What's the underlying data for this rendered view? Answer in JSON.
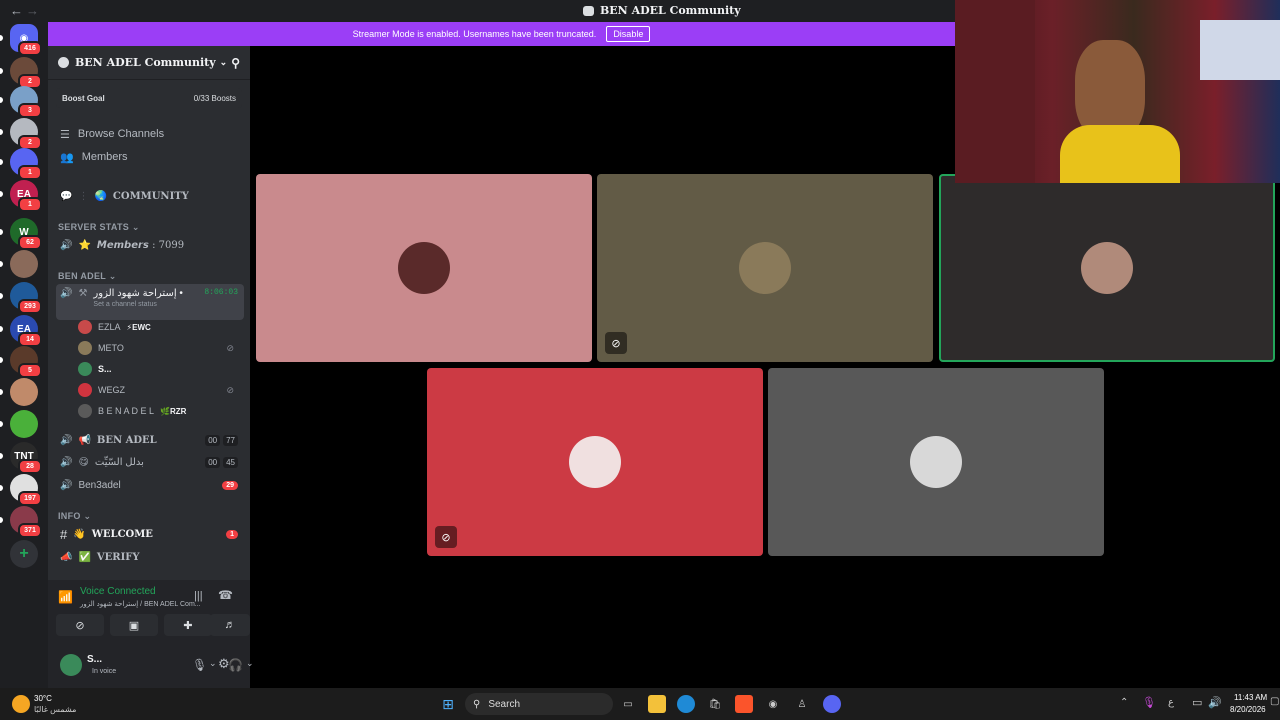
{
  "window": {
    "title": "BEN ADEL Community",
    "nav_back": "←",
    "nav_forward": "→"
  },
  "rail": {
    "servers": [
      {
        "kind": "home",
        "badge": "416",
        "color": "#5865f2"
      },
      {
        "kind": "avatar",
        "badge": "2",
        "color": "#6b4a3a"
      },
      {
        "kind": "avatar",
        "badge": "3",
        "color": "#7aa0c8"
      },
      {
        "kind": "avatar",
        "badge": "2",
        "color": "#b5b9c0"
      },
      {
        "kind": "avatar",
        "badge": "1",
        "color": "#5865f2"
      },
      {
        "kind": "text",
        "text": "EA",
        "badge": "1",
        "color": "#c02050"
      },
      {
        "kind": "text",
        "text": "W",
        "badge": "62",
        "color": "#1f6a2a"
      },
      {
        "kind": "avatar",
        "badge": "",
        "color": "#8a6a5a"
      },
      {
        "kind": "avatar",
        "badge": "293",
        "color": "#1f5a9a"
      },
      {
        "kind": "text",
        "text": "EA",
        "badge": "14",
        "color": "#2a4ab0"
      },
      {
        "kind": "avatar",
        "badge": "5",
        "color": "#5a3a2a"
      },
      {
        "kind": "avatar",
        "badge": "",
        "color": "#c08a6a"
      },
      {
        "kind": "avatar",
        "badge": "",
        "color": "#4ab03a"
      },
      {
        "kind": "text",
        "text": "TNT",
        "badge": "28",
        "color": "#2a2a2a"
      },
      {
        "kind": "avatar",
        "badge": "197",
        "color": "#e0e0e0"
      },
      {
        "kind": "avatar",
        "badge": "371",
        "color": "#8a3a4a"
      }
    ],
    "add_server": "+"
  },
  "banner": {
    "text": "Streamer Mode is enabled. Usernames have been truncated.",
    "button": "Disable"
  },
  "server": {
    "name": "BEN ADEL Community",
    "boost_label": "Boost Goal",
    "boost_value": "0/33 Boosts",
    "browse": "Browse Channels",
    "members": "Members"
  },
  "channels": {
    "community": "COMMUNITY",
    "cat_stats": "SERVER STATS",
    "members_stat": "𝙈𝙚𝙢𝙗𝙚𝙧𝙨 : 7099",
    "cat_benadel": "BEN ADEL",
    "voice_active": "إستراحة شهود الزور •",
    "voice_timer": "8:06:03",
    "voice_status": "Set a channel status",
    "members_list": [
      {
        "name": "EZLA",
        "tag": "⚡EWC",
        "color": "#c84a4a",
        "muted": false
      },
      {
        "name": "METO",
        "tag": "",
        "color": "#8a7a5a",
        "muted": true
      },
      {
        "name": "S...",
        "tag": "",
        "color": "#3a8a5a",
        "muted": false
      },
      {
        "name": "WEGZ",
        "tag": "",
        "color": "#d0343f",
        "muted": true
      },
      {
        "name": "B E N A D E L",
        "tag": "🌿RZR",
        "color": "#5a5a5a",
        "muted": false
      }
    ],
    "voice2": "BEN ADEL",
    "voice2_counts": [
      "00",
      "77"
    ],
    "voice3": "بدلل السّيِّت",
    "voice3_counts": [
      "00",
      "45"
    ],
    "voice4": "Ben3adel",
    "voice4_badge": "29",
    "cat_info": "INFO",
    "welcome": "WELCOME",
    "welcome_badge": "1",
    "verify": "VERIFY"
  },
  "voice_panel": {
    "status": "Voice Connected",
    "location": "إستراحة شهود الزور / BEN ADEL Com..."
  },
  "user": {
    "name": "S...",
    "status": "In voice"
  },
  "tiles": [
    {
      "bg": "#c98a8d",
      "avatar": "#5a2a2a",
      "muted": false,
      "speaking": false
    },
    {
      "bg": "#625b46",
      "avatar": "#8a7a5a",
      "muted": true,
      "speaking": false
    },
    {
      "bg": "#2e2b2b",
      "avatar": "#b08a7a",
      "muted": false,
      "speaking": true
    },
    {
      "bg": "#cc3a44",
      "avatar": "#f0e0e0",
      "muted": true,
      "speaking": false
    },
    {
      "bg": "#585858",
      "avatar": "#d8d8d8",
      "muted": false,
      "speaking": false
    }
  ],
  "taskbar": {
    "weather_temp": "30°C",
    "weather_desc": "مشمس غالبًا",
    "search": "Search",
    "time": "11:43 AM",
    "date": "8/20/2026",
    "lang": "ع"
  }
}
